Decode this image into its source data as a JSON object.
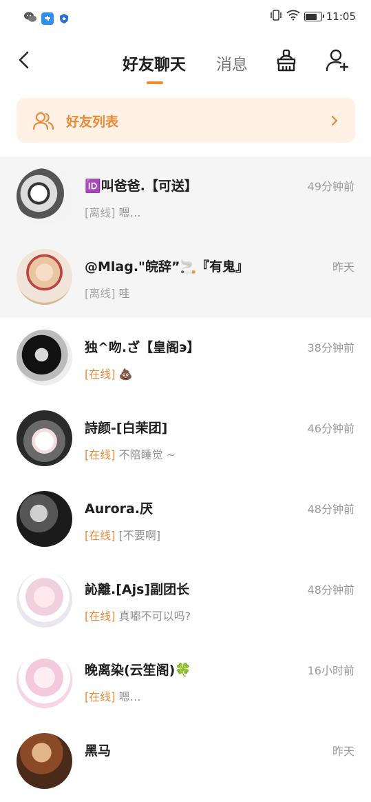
{
  "status_bar": {
    "time": "11:05",
    "battery_level": 0.85,
    "left_icons": [
      "wechat-icon",
      "puzzle-app-icon",
      "shield-app-icon"
    ],
    "right_icons": [
      "vibrate-icon",
      "wifi-icon",
      "battery-icon"
    ]
  },
  "header": {
    "tabs": [
      {
        "label": "好友聊天",
        "selected": true
      },
      {
        "label": "消息",
        "selected": false
      }
    ],
    "icons": [
      "back-arrow-icon",
      "broom-icon",
      "add-user-icon"
    ]
  },
  "banner": {
    "label": "好友列表",
    "icon": "users-icon"
  },
  "colors": {
    "accent": "#e98a36",
    "banner_bg": "#fff1e6",
    "pinned_bg": "#f5f5f5"
  },
  "friends": [
    {
      "name": "🆔叫爸爸.【可送】",
      "time": "49分钟前",
      "status": "[离线]",
      "online": false,
      "message": "嗯…",
      "pinned": true
    },
    {
      "name": "@Mlag.\"皖辞”🚬『有鬼』",
      "time": "昨天",
      "status": "[离线]",
      "online": false,
      "message": "哇",
      "pinned": true
    },
    {
      "name": "独^吻.ざ【皇阁э】",
      "time": "38分钟前",
      "status": "[在线]",
      "online": true,
      "message": "💩",
      "pinned": false
    },
    {
      "name": "詩颜-[白茉团]",
      "time": "46分钟前",
      "status": "[在线]",
      "online": true,
      "message": "不陪睡觉 ~",
      "pinned": false
    },
    {
      "name": "Aurora.厌",
      "time": "48分钟前",
      "status": "[在线]",
      "online": true,
      "message": "[不要啊]",
      "pinned": false
    },
    {
      "name": "訫離.[Ajs]副团长",
      "time": "48分钟前",
      "status": "[在线]",
      "online": true,
      "message": "真嘟不可以吗?",
      "pinned": false
    },
    {
      "name": "晚离染(云笙阁)🍀",
      "time": "16小时前",
      "status": "[在线]",
      "online": true,
      "message": "嗯…",
      "pinned": false
    },
    {
      "name": "黑马",
      "time": "昨天",
      "status": "",
      "online": false,
      "message": "",
      "pinned": false
    }
  ]
}
